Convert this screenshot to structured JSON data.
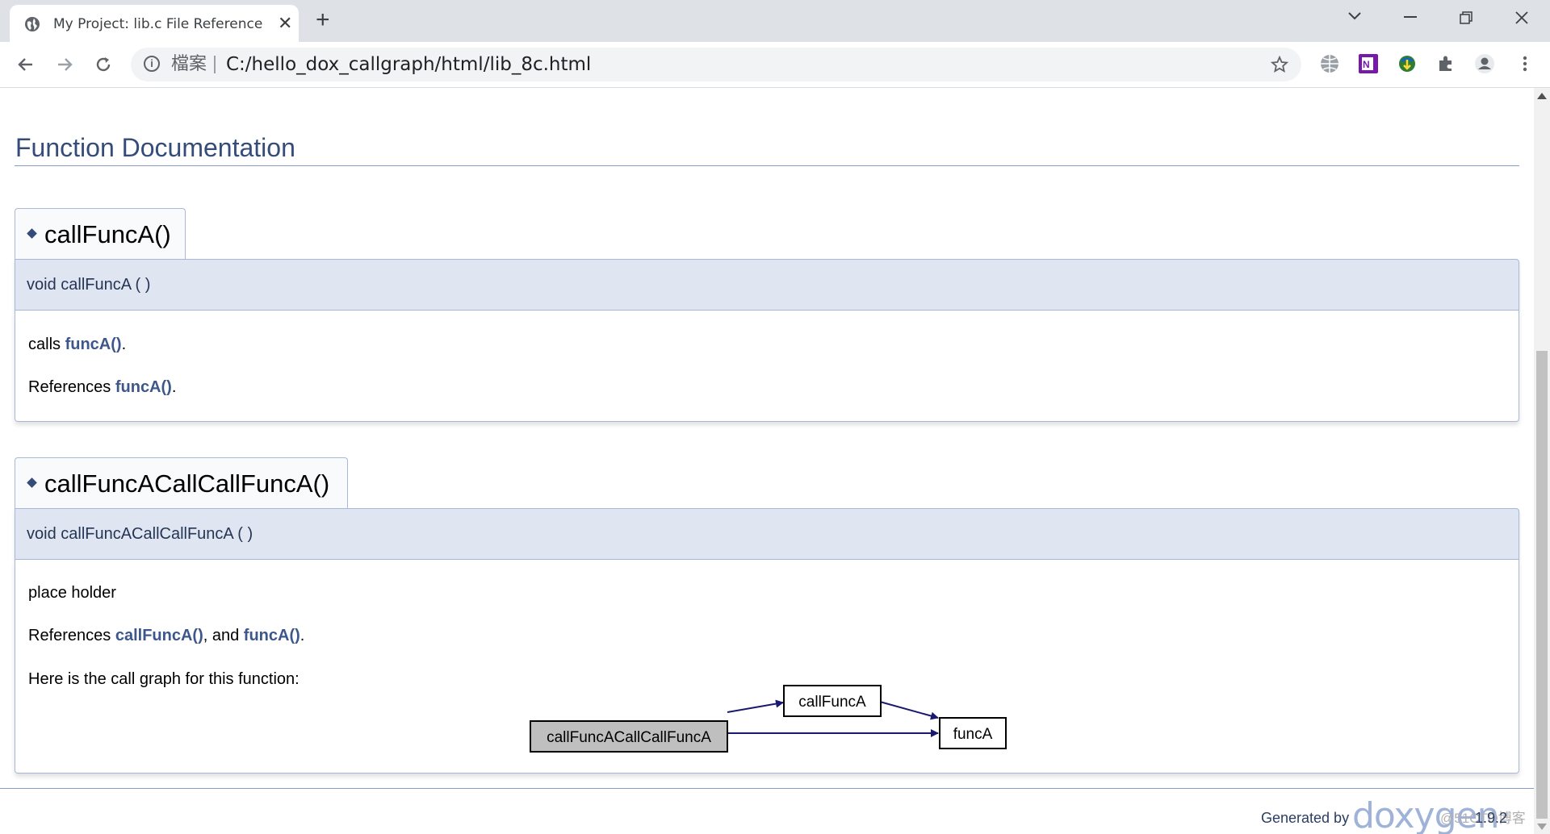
{
  "browser": {
    "tab_title": "My Project: lib.c File Reference",
    "tab_close": "✕",
    "new_tab": "+",
    "site_label": "檔案",
    "url": "C:/hello_dox_callgraph/html/lib_8c.html"
  },
  "page": {
    "section_heading": "Function Documentation",
    "members": [
      {
        "title": "callFuncA()",
        "prototype": "void callFuncA (  )",
        "description": "calls ",
        "description_link": "funcA()",
        "description_end": ".",
        "references_prefix": "References ",
        "references_link": "funcA()",
        "references_end": "."
      },
      {
        "title": "callFuncACallCallFuncA()",
        "prototype": "void callFuncACallCallFuncA (  )",
        "description": "place holder",
        "references_prefix": "References ",
        "references_link1": "callFuncA()",
        "references_mid": ", and ",
        "references_link2": "funcA()",
        "references_end": ".",
        "callgraph_caption": "Here is the call graph for this function:",
        "callgraph": {
          "nodes": [
            "callFuncACallCallFuncA",
            "callFuncA",
            "funcA"
          ]
        }
      }
    ],
    "footer": {
      "generated_by": "Generated by",
      "logo_text": "doxygen",
      "version": "1.9.2",
      "watermark": "@51CTO博客"
    }
  },
  "colors": {
    "heading": "#354c7b",
    "link": "#3d578c",
    "proto_bg": "#dfe5f1",
    "border": "#a8b8d9",
    "graph_edge": "#191970",
    "root_node_fill": "#bfbfbf"
  }
}
